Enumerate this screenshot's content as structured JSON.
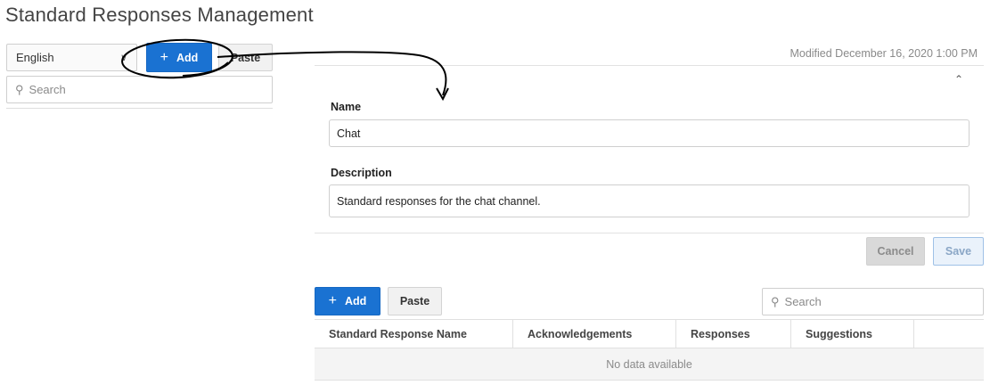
{
  "page": {
    "title": "Standard Responses Management"
  },
  "left": {
    "language": {
      "selected": "English"
    },
    "add_label": "Add",
    "paste_label": "Paste",
    "search": {
      "placeholder": "Search"
    }
  },
  "detail": {
    "modified": "Modified December 16, 2020 1:00 PM",
    "name_label": "Name",
    "name_value": "Chat",
    "description_label": "Description",
    "description_value": "Standard responses for the chat channel.",
    "cancel_label": "Cancel",
    "save_label": "Save"
  },
  "responses": {
    "add_label": "Add",
    "paste_label": "Paste",
    "search": {
      "placeholder": "Search"
    },
    "columns": [
      "Standard Response Name",
      "Acknowledgements",
      "Responses",
      "Suggestions",
      ""
    ],
    "empty_text": "No data available"
  },
  "colors": {
    "primary": "#1a72d2",
    "annotation": "#000000"
  }
}
